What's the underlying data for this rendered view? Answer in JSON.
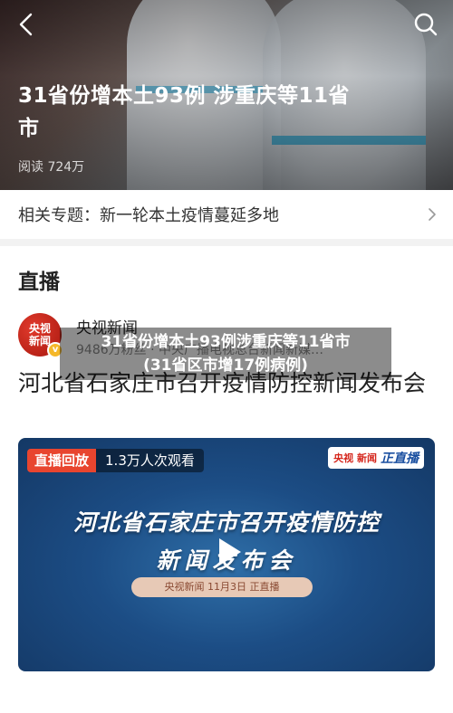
{
  "hero": {
    "title": "31省份增本土93例 涉重庆等11省市",
    "reads": "阅读 724万"
  },
  "topic": {
    "label": "相关专题：",
    "value": "新一轮本土疫情蔓延多地"
  },
  "live": {
    "heading": "直播",
    "account_avatar_line1": "央视",
    "account_avatar_line2": "新闻",
    "account_name": "央视新闻",
    "account_sub": "9486万粉丝 · 中央广播电视总台新闻新媒…",
    "title": "河北省石家庄市召开疫情防控新闻发布会",
    "video": {
      "tag_replay": "直播回放",
      "tag_viewers": "1.3万人次观看",
      "logo_text": "央视 新闻",
      "logo_live": "正直播",
      "title_line1": "河北省石家庄市召开疫情防控",
      "title_line2": "新闻发布会",
      "pill": "央视新闻 11月3日 正直播"
    }
  },
  "caption": {
    "line1": "31省份增本土93例涉重庆等11省市",
    "line2": "(31省区市增17例病例)"
  },
  "colors": {
    "accent_red": "#e8452f",
    "video_blue": "#1c4d85",
    "verified_badge": "#f5b82a"
  }
}
